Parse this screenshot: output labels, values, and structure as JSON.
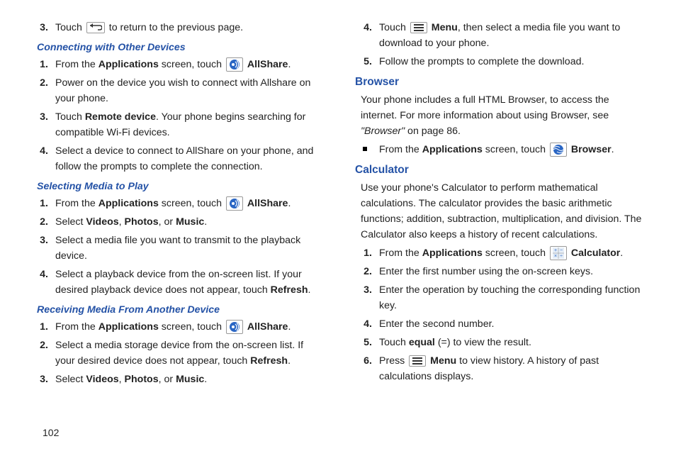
{
  "pageNumber": "102",
  "left": {
    "topList": [
      {
        "n": "3.",
        "pre": "Touch ",
        "icon": "back",
        "post": " to return to the previous page."
      }
    ],
    "sec1": {
      "heading": "Connecting with Other Devices",
      "items": [
        {
          "n": "1.",
          "segments": [
            "From the ",
            {
              "b": "Applications"
            },
            " screen, touch ",
            {
              "icon": "allshare"
            },
            " ",
            {
              "b": "AllShare"
            },
            "."
          ]
        },
        {
          "n": "2.",
          "segments": [
            "Power on the device you wish to connect with Allshare on your phone."
          ]
        },
        {
          "n": "3.",
          "segments": [
            "Touch ",
            {
              "b": "Remote device"
            },
            ". Your phone begins searching for compatible Wi-Fi devices."
          ]
        },
        {
          "n": "4.",
          "segments": [
            "Select a device to connect to AllShare on your phone, and follow the prompts to complete the connection."
          ]
        }
      ]
    },
    "sec2": {
      "heading": "Selecting Media to Play",
      "items": [
        {
          "n": "1.",
          "segments": [
            "From the ",
            {
              "b": "Applications"
            },
            " screen, touch ",
            {
              "icon": "allshare"
            },
            " ",
            {
              "b": "AllShare"
            },
            "."
          ]
        },
        {
          "n": "2.",
          "segments": [
            "Select ",
            {
              "b": "Videos"
            },
            ", ",
            {
              "b": "Photos"
            },
            ", or ",
            {
              "b": "Music"
            },
            "."
          ]
        },
        {
          "n": "3.",
          "segments": [
            "Select a media file you want to transmit to the playback device."
          ]
        },
        {
          "n": "4.",
          "segments": [
            "Select a playback device from the on-screen list. If your desired playback device does not appear, touch ",
            {
              "b": "Refresh"
            },
            "."
          ]
        }
      ]
    },
    "sec3": {
      "heading": "Receiving Media From Another Device",
      "items": [
        {
          "n": "1.",
          "segments": [
            "From the ",
            {
              "b": "Applications"
            },
            " screen, touch ",
            {
              "icon": "allshare"
            },
            " ",
            {
              "b": "AllShare"
            },
            "."
          ]
        },
        {
          "n": "2.",
          "segments": [
            "Select a media storage device from the on-screen list. If your desired device does not appear, touch ",
            {
              "b": "Refresh"
            },
            "."
          ]
        },
        {
          "n": "3.",
          "segments": [
            "Select ",
            {
              "b": "Videos"
            },
            ", ",
            {
              "b": "Photos"
            },
            ", or ",
            {
              "b": "Music"
            },
            "."
          ]
        }
      ]
    }
  },
  "right": {
    "topList": [
      {
        "n": "4.",
        "segments": [
          "Touch ",
          {
            "icon": "menu"
          },
          " ",
          {
            "b": "Menu"
          },
          ", then select a media file you want to download to your phone."
        ]
      },
      {
        "n": "5.",
        "segments": [
          "Follow the prompts to complete the download."
        ]
      }
    ],
    "browser": {
      "heading": "Browser",
      "intro1": "Your phone includes a full HTML Browser, to access the internet. For more information about using Browser, see ",
      "introItalic": "\"Browser\"",
      "intro2": " on page 86.",
      "bullet": {
        "segments": [
          "From the ",
          {
            "b": "Applications"
          },
          " screen, touch ",
          {
            "icon": "browser"
          },
          " ",
          {
            "b": "Browser"
          },
          "."
        ]
      }
    },
    "calculator": {
      "heading": "Calculator",
      "intro": "Use your phone's Calculator to perform mathematical calculations. The calculator provides the basic arithmetic functions; addition, subtraction, multiplication, and division. The Calculator also keeps a history of recent calculations.",
      "items": [
        {
          "n": "1.",
          "segments": [
            "From the ",
            {
              "b": "Applications"
            },
            " screen, touch ",
            {
              "icon": "calculator"
            },
            " ",
            {
              "b": "Calculator"
            },
            "."
          ]
        },
        {
          "n": "2.",
          "segments": [
            "Enter the first number using the on-screen keys."
          ]
        },
        {
          "n": "3.",
          "segments": [
            "Enter the operation by touching the corresponding function key."
          ]
        },
        {
          "n": "4.",
          "segments": [
            "Enter the second number."
          ]
        },
        {
          "n": "5.",
          "segments": [
            "Touch ",
            {
              "b": "equal"
            },
            " (=) to view the result."
          ]
        },
        {
          "n": "6.",
          "segments": [
            "Press ",
            {
              "icon": "menu"
            },
            " ",
            {
              "b": "Menu"
            },
            " to view history. A history of past calculations displays."
          ]
        }
      ]
    }
  }
}
